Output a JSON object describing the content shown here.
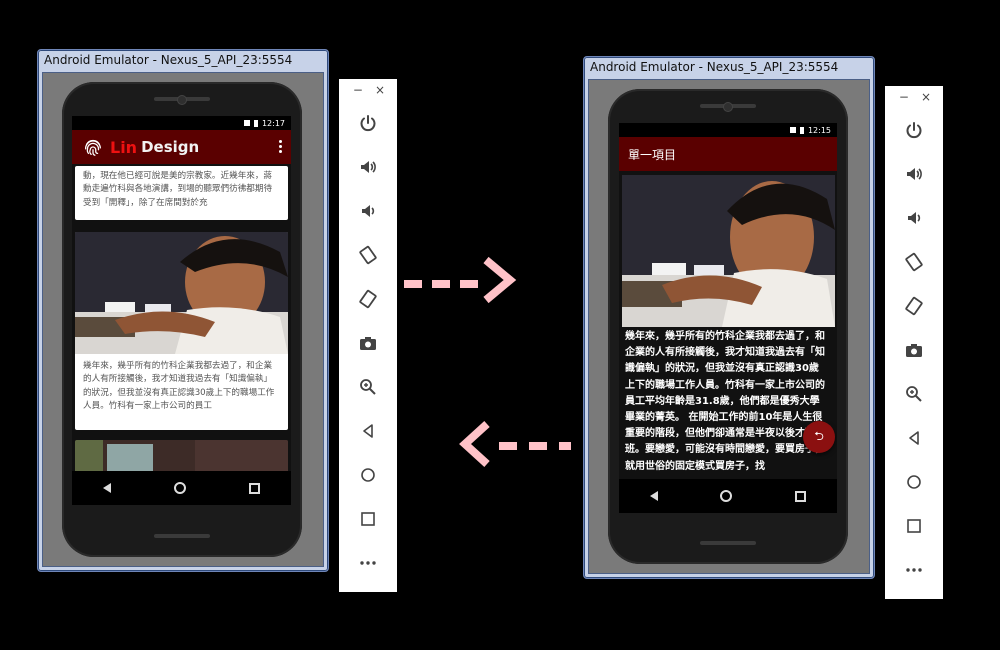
{
  "left_emulator": {
    "title": "Android Emulator - Nexus_5_API_23:5554",
    "status_time": "12:17",
    "app": {
      "logo_word_1": "Lin",
      "logo_word_2": "Design"
    },
    "cards": [
      "動，現在他已經可說是美的宗教家。近幾年來，蔣勳走遍竹科與各地演講，到場的聽眾們彷彿都期待受到「開釋」，除了在席間對於充",
      "幾年來，幾乎所有的竹科企業我都去過了，和企業的人有所接觸後，我才知道我過去有「知識偏執」的狀況，但我並沒有真正認識30歲上下的職場工作人員。竹科有一家上市公司的員工"
    ]
  },
  "right_emulator": {
    "title": "Android Emulator - Nexus_5_API_23:5554",
    "status_time": "12:15",
    "page_title": "單一項目",
    "body_text": "幾年來，幾乎所有的竹科企業我都去過了，和企業的人有所接觸後，我才知道我過去有「知識偏執」的狀況，但我並沒有真正認識30歲上下的職場工作人員。竹科有一家上市公司的員工平均年齡是31.8歲，他們都是優秀大學畢業的菁英。 在開始工作的前10年是人生很重要的階段，但他們卻通常是半夜以後才下班。要戀愛，可能沒有時間戀愛，要買房子，就用世俗的固定模式買房子，找"
  },
  "toolbar": {
    "minimize": "−",
    "close": "×",
    "buttons": [
      "power-icon",
      "volume-up-icon",
      "volume-down-icon",
      "rotate-left-icon",
      "rotate-right-icon",
      "camera-icon",
      "zoom-icon",
      "back-icon",
      "home-icon",
      "overview-icon",
      "more-icon"
    ]
  },
  "colors": {
    "appbar": "#5a0000",
    "logo_red": "#e11111",
    "arrow_pink": "#ffc2c8",
    "fab": "#8b1010"
  }
}
